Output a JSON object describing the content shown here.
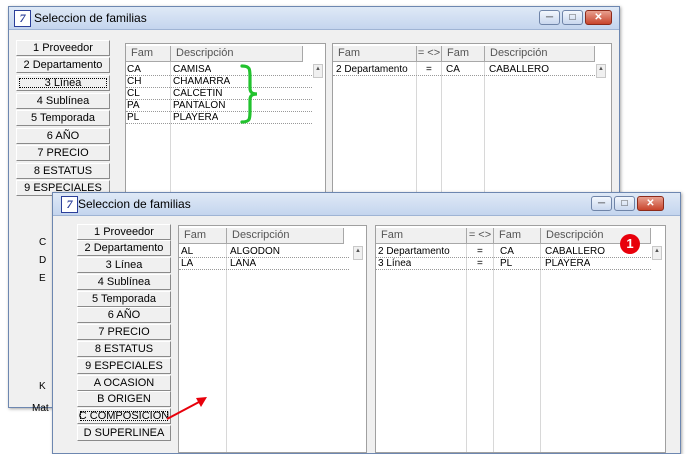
{
  "window_title": "Seleccion de familias",
  "app_icon_glyph": "7",
  "brace_color": "#22c22e",
  "arrow_color": "#e8000b",
  "back": {
    "sidebar": [
      "1 Proveedor",
      "2 Departamento",
      "3 Línea",
      "4 Sublínea",
      "5 Temporada",
      "6 AÑO",
      "7 PRECIO",
      "8 ESTATUS",
      "9 ESPECIALES"
    ],
    "fam_headers": {
      "fam": "Fam",
      "desc": "Descripción"
    },
    "fam_rows": [
      {
        "code": "CA",
        "desc": "CAMISA"
      },
      {
        "code": "CH",
        "desc": "CHAMARRA"
      },
      {
        "code": "CL",
        "desc": "CALCETIN"
      },
      {
        "code": "PA",
        "desc": "PANTALON"
      },
      {
        "code": "PL",
        "desc": "PLAYERA"
      }
    ],
    "filter_headers": {
      "fam": "Fam",
      "op": "= <>",
      "fam2": "Fam",
      "desc": "Descripción"
    },
    "filter_rows": [
      {
        "fam": "2 Departamento",
        "op": "=",
        "code": "CA",
        "desc": "CABALLERO"
      }
    ],
    "peek_letters": [
      "C",
      "D",
      "E",
      "K"
    ],
    "peek_bottom": "Mat"
  },
  "front": {
    "sidebar": [
      "1 Proveedor",
      "2 Departamento",
      "3 Línea",
      "4 Sublínea",
      "5 Temporada",
      "6 AÑO",
      "7 PRECIO",
      "8 ESTATUS",
      "9 ESPECIALES",
      "A OCASION",
      "B ORIGEN",
      "C COMPOSICION",
      "D SUPERLINEA"
    ],
    "fam_headers": {
      "fam": "Fam",
      "desc": "Descripción"
    },
    "fam_rows": [
      {
        "code": "AL",
        "desc": "ALGODON"
      },
      {
        "code": "LA",
        "desc": "LANA"
      }
    ],
    "filter_headers": {
      "fam": "Fam",
      "op": "= <>",
      "fam2": "Fam",
      "desc": "Descripción"
    },
    "filter_rows": [
      {
        "fam": "2 Departamento",
        "op": "=",
        "code": "CA",
        "desc": "CABALLERO"
      },
      {
        "fam": "3 Línea",
        "op": "=",
        "code": "PL",
        "desc": "PLAYERA"
      }
    ],
    "badge": "1"
  }
}
